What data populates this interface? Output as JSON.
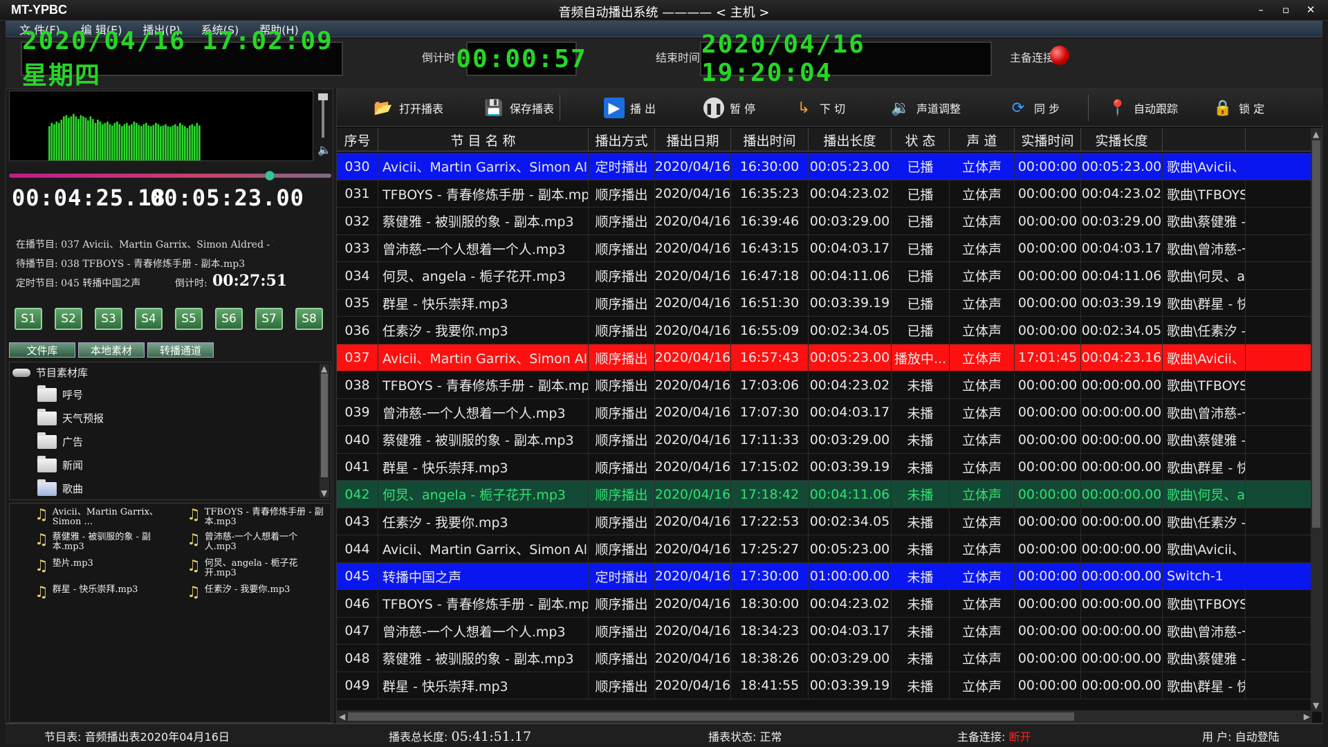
{
  "window": {
    "app_name": "MT-YPBC",
    "title": "音频自动播出系统 ———— < 主机 >",
    "controls": [
      "–",
      "▫",
      "✕"
    ]
  },
  "menu": [
    "文 件(F)",
    "编 辑(E)",
    "播出(P)",
    "系统(S)",
    "帮助(H)"
  ],
  "top": {
    "clock": "2020/04/16  17:02:09  星期四",
    "countdown_label": "倒计时",
    "countdown": "00:00:57",
    "end_label": "结束时间",
    "end_time": "2020/04/16  19:20:04",
    "backup_label": "主备连接"
  },
  "player": {
    "spectrum_levels": [
      0.55,
      0.6,
      0.58,
      0.62,
      0.6,
      0.65,
      0.7,
      0.72,
      0.68,
      0.7,
      0.74,
      0.7,
      0.66,
      0.72,
      0.7,
      0.68,
      0.64,
      0.7,
      0.66,
      0.6,
      0.65,
      0.62,
      0.58,
      0.6,
      0.62,
      0.58,
      0.56,
      0.6,
      0.62,
      0.58,
      0.55,
      0.58,
      0.6,
      0.56,
      0.58,
      0.62,
      0.6,
      0.57,
      0.55,
      0.58,
      0.6,
      0.56,
      0.55,
      0.57,
      0.6,
      0.58,
      0.55,
      0.56,
      0.58,
      0.55,
      0.54,
      0.56,
      0.58,
      0.55,
      0.6,
      0.57,
      0.55,
      0.52,
      0.56,
      0.58,
      0.55,
      0.6,
      0.56
    ],
    "position_fraction": 0.81,
    "elapsed": "00:04:25.18",
    "total": "00:05:23.00",
    "now_playing": "在播节目: 037 Avicii、Martin Garrix、Simon Aldred - Waiting For Love",
    "next_up": "待播节目: 038 TFBOYS - 青春修炼手册 - 副本.mp3",
    "timed": "定时节目: 045 转播中国之声",
    "timed_cd_label": "倒计时:",
    "timed_cd": "00:27:51",
    "slots": [
      "S1",
      "S2",
      "S3",
      "S4",
      "S5",
      "S6",
      "S7",
      "S8"
    ],
    "tabs": [
      "文件库",
      "本地素材",
      "转播通道"
    ],
    "tree_root": "节目素材库",
    "tree_items": [
      "呼号",
      "天气预报",
      "广告",
      "新闻",
      "歌曲"
    ],
    "files": [
      "Avicii、Martin Garrix、Simon ...",
      "TFBOYS - 青春修炼手册 - 副本.mp3",
      "蔡健雅 - 被驯服的象 - 副本.mp3",
      "曾沛慈-一个人想着一个人.mp3",
      "垫片.mp3",
      "何炅、angela - 栀子花开.mp3",
      "群星 - 快乐崇拜.mp3",
      "任素汐 - 我要你.mp3"
    ]
  },
  "toolbar": [
    {
      "label": "打开播表",
      "icon": "folder-open-icon"
    },
    {
      "label": "保存播表",
      "icon": "save-icon"
    },
    {
      "label": "播 出",
      "icon": "play-icon"
    },
    {
      "label": "暂 停",
      "icon": "pause-icon"
    },
    {
      "label": "下 切",
      "icon": "cut-icon"
    },
    {
      "label": "声道调整",
      "icon": "speaker-icon"
    },
    {
      "label": "同 步",
      "icon": "sync-icon"
    },
    {
      "label": "自动跟踪",
      "icon": "pin-icon"
    },
    {
      "label": "锁 定",
      "icon": "lock-icon"
    }
  ],
  "table": {
    "columns": [
      "序号",
      "节 目 名 称",
      "播出方式",
      "播出日期",
      "播出时间",
      "播出长度",
      "状 态",
      "声 道",
      "实播时间",
      "实播长度",
      ""
    ],
    "rows": [
      [
        "030",
        "Avicii、Martin Garrix、Simon Aldred ...",
        "定时播出",
        "2020/04/16",
        "16:30:00",
        "00:05:23.00",
        "已播",
        "立体声",
        "00:00:00",
        "00:05:23.00",
        "歌曲\\Avicii、Ma"
      ],
      [
        "031",
        "TFBOYS - 青春修炼手册 - 副本.mp3",
        "顺序播出",
        "2020/04/16",
        "16:35:23",
        "00:04:23.02",
        "已播",
        "立体声",
        "00:00:00",
        "00:04:23.02",
        "歌曲\\TFBOYS - 青"
      ],
      [
        "032",
        "蔡健雅 - 被驯服的象 - 副本.mp3",
        "顺序播出",
        "2020/04/16",
        "16:39:46",
        "00:03:29.00",
        "已播",
        "立体声",
        "00:00:00",
        "00:03:29.00",
        "歌曲\\蔡健雅 - 被"
      ],
      [
        "033",
        "曾沛慈-一个人想着一个人.mp3",
        "顺序播出",
        "2020/04/16",
        "16:43:15",
        "00:04:03.17",
        "已播",
        "立体声",
        "00:00:00",
        "00:04:03.17",
        "歌曲\\曾沛慈-一个"
      ],
      [
        "034",
        "何炅、angela - 栀子花开.mp3",
        "顺序播出",
        "2020/04/16",
        "16:47:18",
        "00:04:11.06",
        "已播",
        "立体声",
        "00:00:00",
        "00:04:11.06",
        "歌曲\\何炅、ange"
      ],
      [
        "035",
        "群星 - 快乐崇拜.mp3",
        "顺序播出",
        "2020/04/16",
        "16:51:30",
        "00:03:39.19",
        "已播",
        "立体声",
        "00:00:00",
        "00:03:39.19",
        "歌曲\\群星 - 快乐"
      ],
      [
        "036",
        "任素汐 - 我要你.mp3",
        "顺序播出",
        "2020/04/16",
        "16:55:09",
        "00:02:34.05",
        "已播",
        "立体声",
        "00:00:00",
        "00:02:34.05",
        "歌曲\\任素汐 - 我"
      ],
      [
        "037",
        "Avicii、Martin Garrix、Simon Aldred ...",
        "顺序播出",
        "2020/04/16",
        "16:57:43",
        "00:05:23.00",
        "播放中...",
        "立体声",
        "17:01:45",
        "00:04:23.16",
        "歌曲\\Avicii、Ma"
      ],
      [
        "038",
        "TFBOYS - 青春修炼手册 - 副本.mp3",
        "顺序播出",
        "2020/04/16",
        "17:03:06",
        "00:04:23.02",
        "未播",
        "立体声",
        "00:00:00",
        "00:00:00.00",
        "歌曲\\TFBOYS - 青"
      ],
      [
        "039",
        "曾沛慈-一个人想着一个人.mp3",
        "顺序播出",
        "2020/04/16",
        "17:07:30",
        "00:04:03.17",
        "未播",
        "立体声",
        "00:00:00",
        "00:00:00.00",
        "歌曲\\曾沛慈-一个"
      ],
      [
        "040",
        "蔡健雅 - 被驯服的象 - 副本.mp3",
        "顺序播出",
        "2020/04/16",
        "17:11:33",
        "00:03:29.00",
        "未播",
        "立体声",
        "00:00:00",
        "00:00:00.00",
        "歌曲\\蔡健雅 - 被"
      ],
      [
        "041",
        "群星 - 快乐崇拜.mp3",
        "顺序播出",
        "2020/04/16",
        "17:15:02",
        "00:03:39.19",
        "未播",
        "立体声",
        "00:00:00",
        "00:00:00.00",
        "歌曲\\群星 - 快乐"
      ],
      [
        "042",
        "何炅、angela - 栀子花开.mp3",
        "顺序播出",
        "2020/04/16",
        "17:18:42",
        "00:04:11.06",
        "未播",
        "立体声",
        "00:00:00",
        "00:00:00.00",
        "歌曲\\何炅、ange"
      ],
      [
        "043",
        "任素汐 - 我要你.mp3",
        "顺序播出",
        "2020/04/16",
        "17:22:53",
        "00:02:34.05",
        "未播",
        "立体声",
        "00:00:00",
        "00:00:00.00",
        "歌曲\\任素汐 - 我"
      ],
      [
        "044",
        "Avicii、Martin Garrix、Simon Aldred ...",
        "顺序播出",
        "2020/04/16",
        "17:25:27",
        "00:05:23.00",
        "未播",
        "立体声",
        "00:00:00",
        "00:00:00.00",
        "歌曲\\Avicii、Ma"
      ],
      [
        "045",
        "转播中国之声",
        "定时播出",
        "2020/04/16",
        "17:30:00",
        "01:00:00.00",
        "未播",
        "立体声",
        "00:00:00",
        "00:00:00.00",
        "Switch-1"
      ],
      [
        "046",
        "TFBOYS - 青春修炼手册 - 副本.mp3",
        "顺序播出",
        "2020/04/16",
        "18:30:00",
        "00:04:23.02",
        "未播",
        "立体声",
        "00:00:00",
        "00:00:00.00",
        "歌曲\\TFBOYS - 青"
      ],
      [
        "047",
        "曾沛慈-一个人想着一个人.mp3",
        "顺序播出",
        "2020/04/16",
        "18:34:23",
        "00:04:03.17",
        "未播",
        "立体声",
        "00:00:00",
        "00:00:00.00",
        "歌曲\\曾沛慈-一个"
      ],
      [
        "048",
        "蔡健雅 - 被驯服的象 - 副本.mp3",
        "顺序播出",
        "2020/04/16",
        "18:38:26",
        "00:03:29.00",
        "未播",
        "立体声",
        "00:00:00",
        "00:00:00.00",
        "歌曲\\蔡健雅 - 被"
      ],
      [
        "049",
        "群星 - 快乐崇拜.mp3",
        "顺序播出",
        "2020/04/16",
        "18:41:55",
        "00:03:39.19",
        "未播",
        "立体声",
        "00:00:00",
        "00:00:00.00",
        "歌曲\\群星 - 快乐"
      ]
    ],
    "row_highlights": {
      "0": "blue",
      "7": "red",
      "12": "green",
      "15": "blue"
    }
  },
  "status": {
    "schedule": "节目表: 音频播出表2020年04月16日",
    "total_label": "播表总长度:",
    "total": "05:41:51.17",
    "state": "播表状态: 正常",
    "link_label": "主备连接:",
    "link_value": "断开",
    "user": "用  户: 自动登陆"
  },
  "colors": {
    "lcd_green": "#27d627",
    "row_blue": "#0a16f0",
    "row_red": "#ff1010",
    "row_green_text": "#31e070",
    "alert_red": "#ff2020"
  }
}
